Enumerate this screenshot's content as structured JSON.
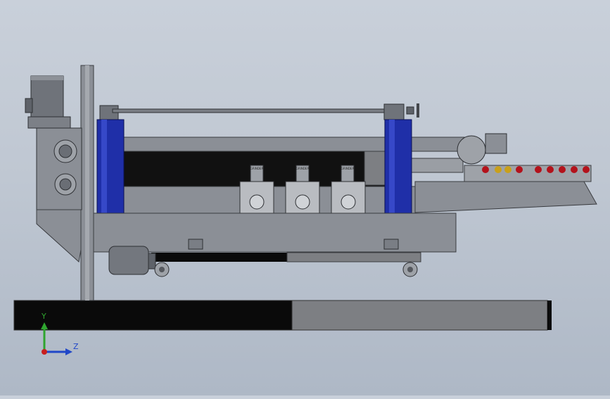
{
  "view": {
    "kind": "cad-3d-viewport",
    "model": "glass edging machine assembly (side view)",
    "background_top": "#c9d0da",
    "background_bottom": "#aeb8c6"
  },
  "colors": {
    "frame": "#8b8f96",
    "frame_dark": "#5e6269",
    "blue_column": "#1f2fa8",
    "black_panel": "#0a0a0a",
    "grey_panel": "#7d7f83",
    "red_roller": "#b3121b",
    "axis_y": "#2fa52f",
    "axis_z": "#2047c8",
    "axis_origin": "#c81e1e"
  },
  "icons": [
    "triad-axes-icon"
  ],
  "triad": {
    "y_label": "Y",
    "z_label": "Z"
  },
  "plates": {
    "grinder_1": "GRINDER",
    "grinder_2": "GRINDER",
    "grinder_3": "GRINDER"
  }
}
